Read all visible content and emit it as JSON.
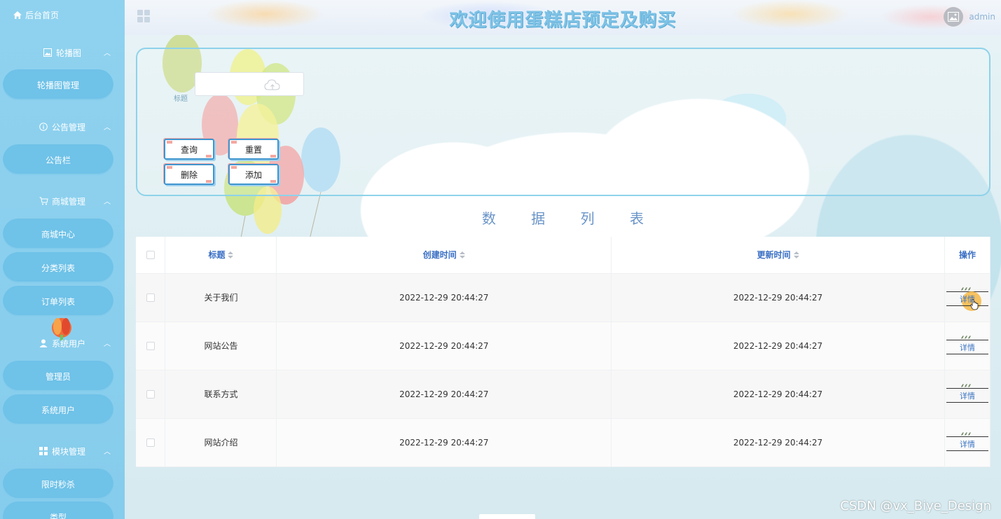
{
  "sidebar": {
    "home": "后台首页",
    "groups": [
      {
        "label": "轮播图",
        "icon": "image-icon",
        "items": [
          "轮播图管理"
        ]
      },
      {
        "label": "公告管理",
        "icon": "info-icon",
        "items": [
          "公告栏"
        ]
      },
      {
        "label": "商城管理",
        "icon": "cart-icon",
        "items": [
          "商城中心",
          "分类列表",
          "订单列表"
        ]
      },
      {
        "label": "系统用户",
        "icon": "user-icon",
        "items": [
          "管理员",
          "系统用户"
        ]
      },
      {
        "label": "模块管理",
        "icon": "grid-icon",
        "items": [
          "限时秒杀",
          "类型"
        ]
      }
    ]
  },
  "header": {
    "title": "欢迎使用蛋糕店预定及购买",
    "username": "admin"
  },
  "search": {
    "title_label": "标题",
    "title_value": "",
    "buttons": {
      "query": "查询",
      "reset": "重置",
      "delete": "删除",
      "add": "添加"
    }
  },
  "table": {
    "section_title": "数 据 列 表",
    "columns": [
      "标题",
      "创建时间",
      "更新时间",
      "操作"
    ],
    "rows": [
      {
        "title": "关于我们",
        "created": "2022-12-29 20:44:27",
        "updated": "2022-12-29 20:44:27",
        "action": "详情"
      },
      {
        "title": "网站公告",
        "created": "2022-12-29 20:44:27",
        "updated": "2022-12-29 20:44:27",
        "action": "详情"
      },
      {
        "title": "联系方式",
        "created": "2022-12-29 20:44:27",
        "updated": "2022-12-29 20:44:27",
        "action": "详情"
      },
      {
        "title": "网站介绍",
        "created": "2022-12-29 20:44:27",
        "updated": "2022-12-29 20:44:27",
        "action": "详情"
      }
    ]
  },
  "watermark": "CSDN @vx_Biye_Design",
  "colors": {
    "sidebar": "#8fd2ef",
    "menu_item": "#6fc2e8",
    "title": "#7fc3e6",
    "table_header_text": "#3a6fc4",
    "link": "#3a73c2"
  }
}
